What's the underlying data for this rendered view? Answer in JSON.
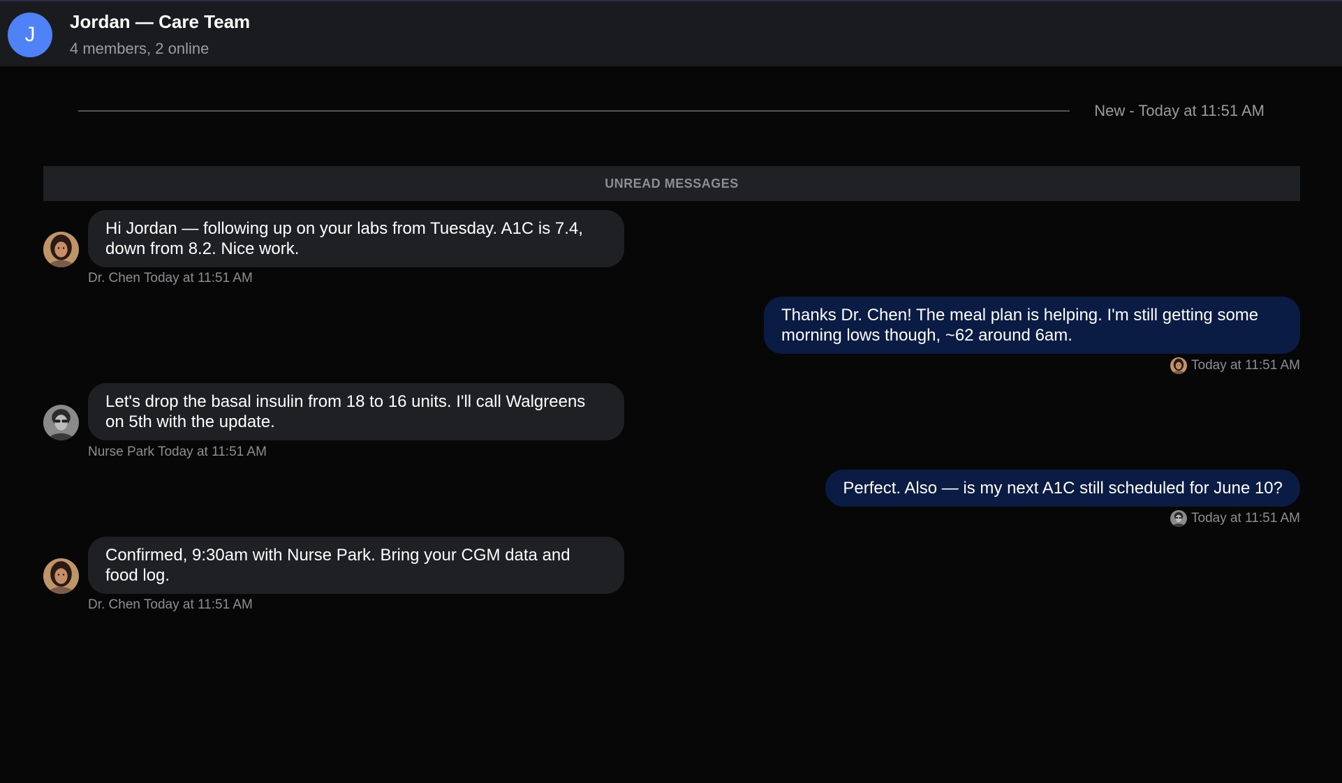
{
  "header": {
    "avatar_initial": "J",
    "title": "Jordan — Care Team",
    "subtitle": "4 members, 2 online"
  },
  "divider": {
    "label": "New - Today at 11:51 AM"
  },
  "unread_banner": "UNREAD MESSAGES",
  "messages": [
    {
      "direction": "incoming",
      "author": "Dr. Chen",
      "avatar": "dr-chen-avatar",
      "text": "Hi Jordan — following up on your labs from Tuesday. A1C is 7.4, down from 8.2. Nice work.",
      "meta": "Dr. Chen Today at 11:51 AM"
    },
    {
      "direction": "outgoing",
      "text": "Thanks Dr. Chen! The meal plan is helping. I'm still getting some morning lows though, ~62 around 6am.",
      "meta": "Today at 11:51 AM",
      "read_avatar": "dr-chen-avatar"
    },
    {
      "direction": "incoming",
      "author": "Nurse Park",
      "avatar": "nurse-park-avatar",
      "text": "Let's drop the basal insulin from 18 to 16 units. I'll call Walgreens on 5th with the update.",
      "meta": "Nurse Park Today at 11:51 AM"
    },
    {
      "direction": "outgoing",
      "text": "Perfect. Also — is my next A1C still scheduled for June 10?",
      "meta": "Today at 11:51 AM",
      "read_avatar": "nurse-park-avatar"
    },
    {
      "direction": "incoming",
      "author": "Dr. Chen",
      "avatar": "dr-chen-avatar",
      "text": "Confirmed, 9:30am with Nurse Park. Bring your CGM data and food log.",
      "meta": "Dr. Chen Today at 11:51 AM"
    }
  ],
  "colors": {
    "background": "#070708",
    "header": "#1a1b1f",
    "incoming_bubble": "#1f2024",
    "outgoing_bubble": "#0a1b44",
    "group_avatar": "#4f82f6"
  }
}
